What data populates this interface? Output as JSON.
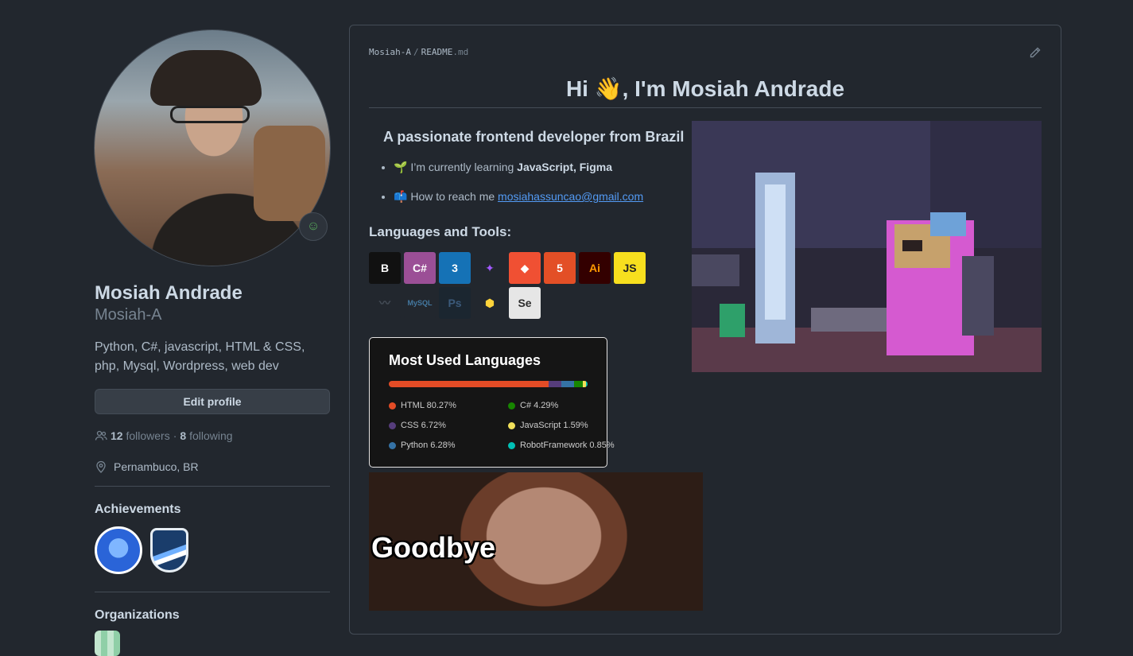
{
  "profile": {
    "name": "Mosiah Andrade",
    "login": "Mosiah-A",
    "bio": "Python, C#, javascript, HTML & CSS, php, Mysql, Wordpress, web dev",
    "edit_label": "Edit profile",
    "followers_count": "12",
    "followers_label": "followers",
    "separator": "·",
    "following_count": "8",
    "following_label": "following",
    "location": "Pernambuco, BR",
    "achievements_title": "Achievements",
    "organizations_title": "Organizations"
  },
  "readme": {
    "breadcrumb_user": "Mosiah-A",
    "breadcrumb_sep": "/",
    "breadcrumb_file": "README",
    "breadcrumb_ext": ".md",
    "heading": "Hi 👋, I'm Mosiah Andrade",
    "subheading": "A passionate frontend developer from Brazil",
    "list": [
      {
        "emoji": "🌱",
        "text": "I’m currently learning ",
        "bold": "JavaScript, Figma"
      },
      {
        "emoji": "📫",
        "text": "How to reach me ",
        "link": "mosiahassuncao@gmail.com"
      }
    ],
    "tools_title": "Languages and Tools:",
    "tools": [
      {
        "name": "bootstrap-icon",
        "glyph": "B",
        "bg": "#111111",
        "fg": "#ffffff"
      },
      {
        "name": "csharp-icon",
        "glyph": "C#",
        "bg": "#9b4f96",
        "fg": "#ffffff"
      },
      {
        "name": "css3-icon",
        "glyph": "3",
        "bg": "#1572b6",
        "fg": "#ffffff"
      },
      {
        "name": "figma-icon",
        "glyph": "✦",
        "bg": "#22272e",
        "fg": "#a259ff"
      },
      {
        "name": "git-icon",
        "glyph": "◆",
        "bg": "#f05033",
        "fg": "#ffffff"
      },
      {
        "name": "html5-icon",
        "glyph": "5",
        "bg": "#e34f26",
        "fg": "#ffffff"
      },
      {
        "name": "illustrator-icon",
        "glyph": "Ai",
        "bg": "#330000",
        "fg": "#ff9a00"
      },
      {
        "name": "javascript-icon",
        "glyph": "JS",
        "bg": "#f7df1e",
        "fg": "#222222"
      },
      {
        "name": "mariadb-icon",
        "glyph": "〰",
        "bg": "#22272e",
        "fg": "#444c56"
      },
      {
        "name": "mysql-icon",
        "glyph": "MySQL",
        "bg": "#22272e",
        "fg": "#4479a1"
      },
      {
        "name": "photoshop-icon",
        "glyph": "Ps",
        "bg": "#1b2630",
        "fg": "#3b5a7a"
      },
      {
        "name": "python-icon",
        "glyph": "⬢",
        "bg": "#22272e",
        "fg": "#ffd43b"
      },
      {
        "name": "selenium-icon",
        "glyph": "Se",
        "bg": "#e6e6e6",
        "fg": "#2d2d2d"
      }
    ],
    "stats": {
      "title": "Most Used Languages",
      "langs": [
        {
          "label": "HTML 80.27%",
          "color": "#e34c26",
          "pct": 80.27
        },
        {
          "label": "CSS 6.72%",
          "color": "#563d7c",
          "pct": 6.72
        },
        {
          "label": "Python 6.28%",
          "color": "#3572a5",
          "pct": 6.28
        },
        {
          "label": "C# 4.29%",
          "color": "#178600",
          "pct": 4.29
        },
        {
          "label": "JavaScript 1.59%",
          "color": "#f1e05a",
          "pct": 1.59
        },
        {
          "label": "RobotFramework 0.85%",
          "color": "#00c0b5",
          "pct": 0.85
        }
      ]
    },
    "gif_caption": "Goodbye"
  },
  "colors": {
    "background": "#22272e",
    "border": "#444c56",
    "link": "#539bf5"
  }
}
